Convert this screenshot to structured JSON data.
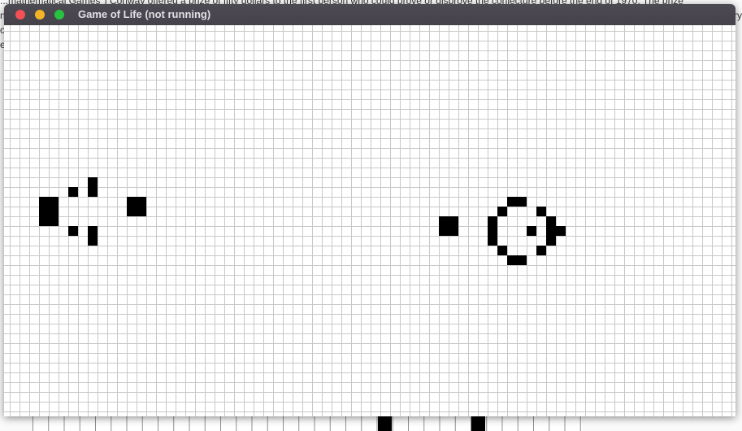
{
  "window": {
    "title": "Game of Life (not running)",
    "controls": {
      "close_color": "#f25056",
      "minimize_color": "#f5b428",
      "maximize_color": "#27c23f"
    }
  },
  "background_text": {
    "line1": "...mathematical Games\") Conway offered a prize of fifty dollars to the first person who could prove or disprove the conjecture before the end of 1970. The prize",
    "line2": "n",
    "line3": "o",
    "line4": "e",
    "right_fragment": "ry"
  },
  "board": {
    "running": false,
    "live_cells": [
      [
        9,
        16
      ],
      [
        7,
        17
      ],
      [
        9,
        17
      ],
      [
        4,
        18
      ],
      [
        5,
        18
      ],
      [
        13,
        18
      ],
      [
        14,
        18
      ],
      [
        4,
        19
      ],
      [
        5,
        19
      ],
      [
        13,
        19
      ],
      [
        14,
        19
      ],
      [
        4,
        20
      ],
      [
        5,
        20
      ],
      [
        7,
        21
      ],
      [
        9,
        21
      ],
      [
        9,
        22
      ],
      [
        52,
        18
      ],
      [
        53,
        18
      ],
      [
        51,
        19
      ],
      [
        55,
        19
      ],
      [
        50,
        20
      ],
      [
        56,
        20
      ],
      [
        45,
        20
      ],
      [
        46,
        20
      ],
      [
        50,
        21
      ],
      [
        54,
        21
      ],
      [
        56,
        21
      ],
      [
        57,
        21
      ],
      [
        45,
        21
      ],
      [
        46,
        21
      ],
      [
        50,
        22
      ],
      [
        56,
        22
      ],
      [
        51,
        23
      ],
      [
        55,
        23
      ],
      [
        52,
        24
      ],
      [
        53,
        24
      ]
    ]
  },
  "bottom_strip": {
    "live_cells": [
      22,
      28
    ]
  }
}
